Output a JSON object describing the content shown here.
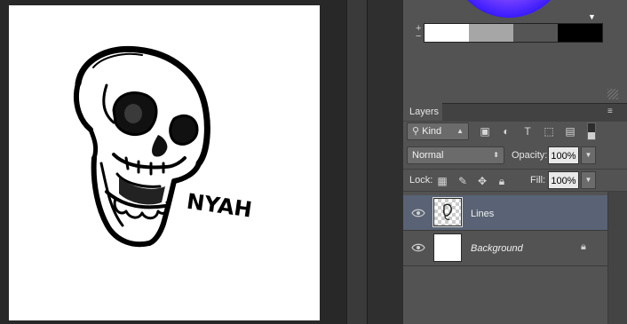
{
  "canvas": {
    "artwork_text": "NYAH"
  },
  "color_panel": {
    "swatches": [
      "#ffffff",
      "#a6a6a6",
      "#555555",
      "#000000"
    ],
    "plus": "+",
    "minus": "−",
    "wheel_marker": "▼"
  },
  "layers_panel": {
    "tab_label": "Layers",
    "menu_icon": "≡",
    "filter": {
      "kind_label": "Kind",
      "icons": [
        "image-filter-icon",
        "adjustment-filter-icon",
        "type-filter-icon",
        "shape-filter-icon",
        "smart-object-filter-icon"
      ]
    },
    "blend_mode": "Normal",
    "opacity_label": "Opacity:",
    "opacity_value": "100%",
    "lock_label": "Lock:",
    "fill_label": "Fill:",
    "fill_value": "100%",
    "layers": [
      {
        "name": "Lines",
        "visible": true,
        "selected": true
      },
      {
        "name": "Background",
        "visible": true,
        "locked": true
      }
    ]
  }
}
